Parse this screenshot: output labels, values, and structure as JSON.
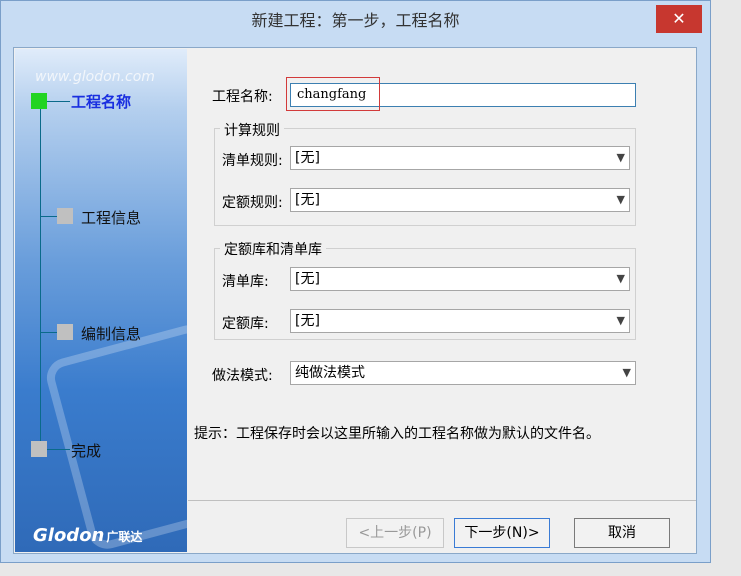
{
  "window": {
    "title": "新建工程：第一步，工程名称",
    "close_glyph": "✕"
  },
  "sidebar": {
    "watermark": "www.glodon.com",
    "logo_text": "Glodon",
    "logo_cn": "广联达",
    "steps": [
      {
        "label": "工程名称",
        "active": true
      },
      {
        "label": "工程信息",
        "active": false
      },
      {
        "label": "编制信息",
        "active": false
      },
      {
        "label": "完成",
        "active": false
      }
    ]
  },
  "form": {
    "project_name_label": "工程名称:",
    "project_name_value": "changfang",
    "calc_rules_title": "计算规则",
    "bill_rule_label": "清单规则:",
    "bill_rule_value": "[无]",
    "quota_rule_label": "定额规则:",
    "quota_rule_value": "[无]",
    "library_title": "定额库和清单库",
    "bill_lib_label": "清单库:",
    "bill_lib_value": "[无]",
    "quota_lib_label": "定额库:",
    "quota_lib_value": "[无]",
    "method_label": "做法模式:",
    "method_value": "纯做法模式",
    "hint": "提示：工程保存时会以这里所输入的工程名称做为默认的文件名。"
  },
  "buttons": {
    "prev": "<上一步(P)",
    "next": "下一步(N)>",
    "cancel": "取消"
  },
  "icons": {
    "dropdown": "chevron-down-icon"
  }
}
